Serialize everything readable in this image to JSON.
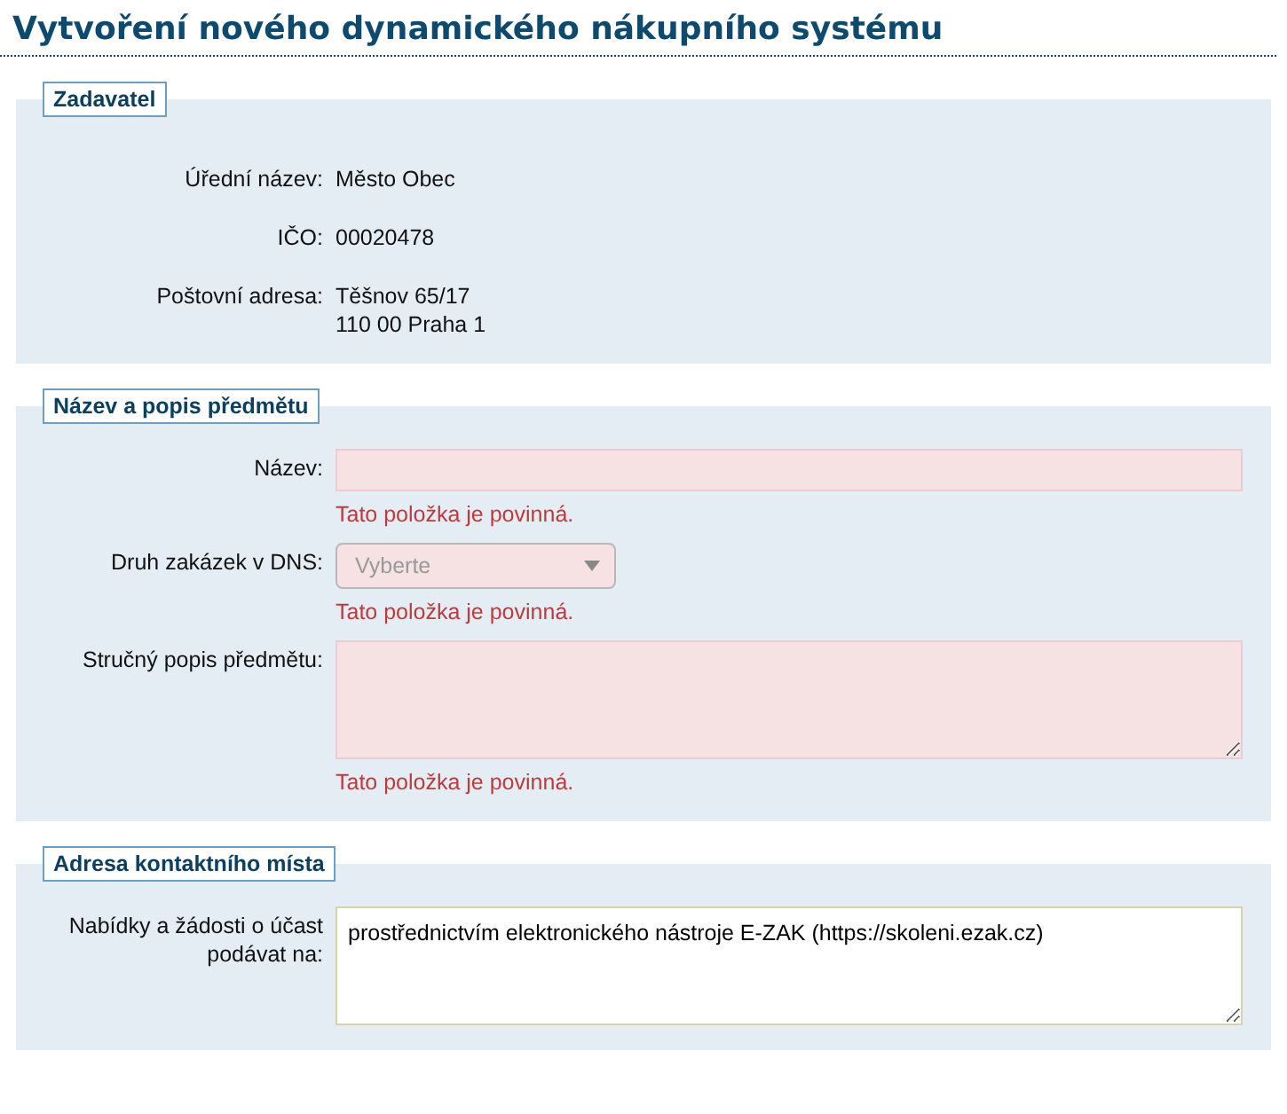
{
  "title": "Vytvoření nového dynamického nákupního systému",
  "sections": [
    {
      "legend": "Zadavatel",
      "rows": [
        {
          "kind": "info",
          "label": "Úřední název:",
          "lines": [
            "Město Obec"
          ]
        },
        {
          "kind": "info",
          "label": "IČO:",
          "lines": [
            "00020478"
          ]
        },
        {
          "kind": "info",
          "label": "Poštovní adresa:",
          "lines": [
            "Těšnov 65/17",
            "110 00 Praha 1"
          ]
        }
      ]
    },
    {
      "legend": "Název a popis předmětu",
      "rows": [
        {
          "kind": "text",
          "label": "Název:",
          "invalid": true,
          "error": "Tato položka je povinná."
        },
        {
          "kind": "select",
          "label": "Druh zakázek v DNS:",
          "placeholder": "Vyberte",
          "invalid": true,
          "error": "Tato položka je povinná."
        },
        {
          "kind": "textarea",
          "label": "Stručný popis předmětu:",
          "invalid": true,
          "error": "Tato položka je povinná."
        }
      ]
    },
    {
      "legend": "Adresa kontaktního místa",
      "rows": [
        {
          "kind": "textarea",
          "label": "Nabídky a žádosti o účast podávat na:",
          "invalid": false,
          "value": "prostřednictvím elektronického nástroje E-ZAK (https://skoleni.ezak.cz)"
        }
      ]
    }
  ]
}
